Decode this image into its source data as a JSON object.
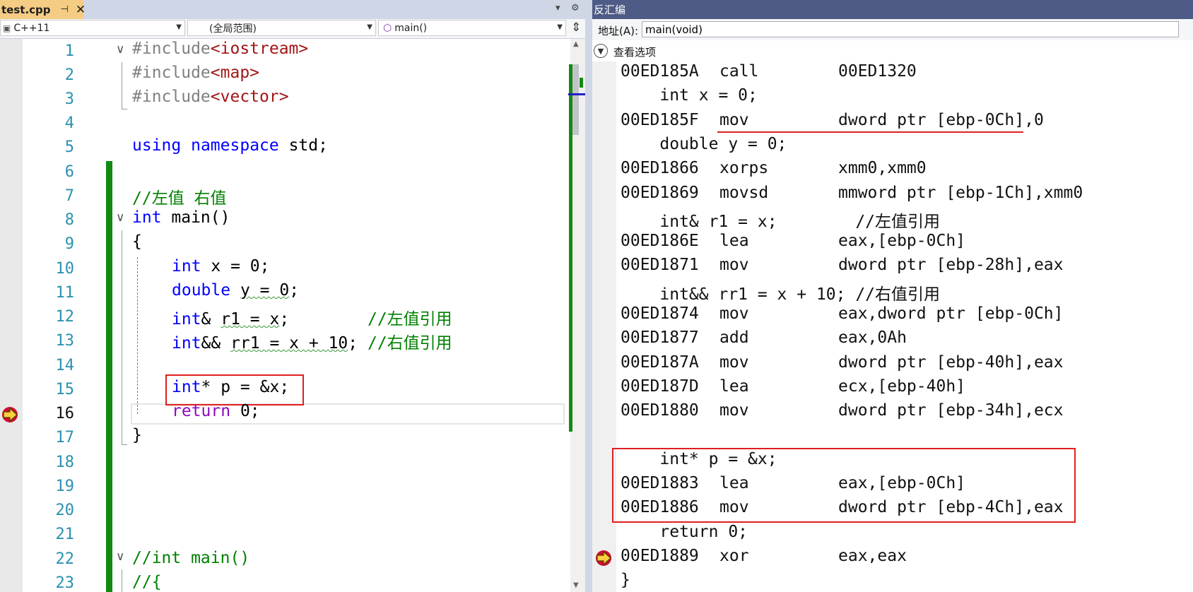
{
  "editor": {
    "tab_name": "test.cpp",
    "tab_pin": "⊣",
    "tab_close": "✕",
    "nav": {
      "project": "C++11",
      "scope": "(全局范围)",
      "function": "main()"
    },
    "line_numbers": [
      "1",
      "2",
      "3",
      "4",
      "5",
      "6",
      "7",
      "8",
      "9",
      "10",
      "11",
      "12",
      "13",
      "14",
      "15",
      "16",
      "17",
      "18",
      "19",
      "20",
      "21",
      "22",
      "23"
    ],
    "code": {
      "l1_pre": "#include",
      "l1_str": "<iostream>",
      "l2_pre": "#include",
      "l2_str": "<map>",
      "l3_pre": "#include",
      "l3_str": "<vector>",
      "l5_kw1": "using",
      "l5_kw2": "namespace",
      "l5_rest": " std;",
      "l7": "//左值 右值",
      "l8_kw": "int",
      "l8_rest": " main()",
      "l9": "{",
      "l10_kw": "int",
      "l10_rest": " x = 0;",
      "l11_kw": "double",
      "l11_sp": " ",
      "l11_sq": "y = 0",
      "l11_end": ";",
      "l12_kw": "int",
      "l12_amp": "& ",
      "l12_sq": "r1 = x",
      "l12_mid": ";        ",
      "l12_cm": "//左值引用",
      "l13_kw": "int",
      "l13_amp": "&& ",
      "l13_sq": "rr1 = x + 10",
      "l13_mid": "; ",
      "l13_cm": "//右值引用",
      "l15_kw": "int",
      "l15_rest": "* p = &x;",
      "l16_kw": "return",
      "l16_rest": " 0;",
      "l17": "}",
      "l22": "//int main()",
      "l23": "//{"
    }
  },
  "disasm": {
    "title": "反汇编",
    "address_label": "地址(A):",
    "address_value": "main(void)",
    "view_options": "查看选项",
    "lines": [
      {
        "addr": "00ED185A",
        "mn": "call",
        "op": "00ED1320"
      },
      {
        "src": "    int x = 0;"
      },
      {
        "addr": "00ED185F",
        "mn": "mov",
        "op": "dword ptr [ebp-0Ch],0"
      },
      {
        "src": "    double y = 0;"
      },
      {
        "addr": "00ED1866",
        "mn": "xorps",
        "op": "xmm0,xmm0"
      },
      {
        "addr": "00ED1869",
        "mn": "movsd",
        "op": "mmword ptr [ebp-1Ch],xmm0"
      },
      {
        "src": "    int& r1 = x;        //左值引用"
      },
      {
        "addr": "00ED186E",
        "mn": "lea",
        "op": "eax,[ebp-0Ch]"
      },
      {
        "addr": "00ED1871",
        "mn": "mov",
        "op": "dword ptr [ebp-28h],eax"
      },
      {
        "src": "    int&& rr1 = x + 10; //右值引用"
      },
      {
        "addr": "00ED1874",
        "mn": "mov",
        "op": "eax,dword ptr [ebp-0Ch]"
      },
      {
        "addr": "00ED1877",
        "mn": "add",
        "op": "eax,0Ah"
      },
      {
        "addr": "00ED187A",
        "mn": "mov",
        "op": "dword ptr [ebp-40h],eax"
      },
      {
        "addr": "00ED187D",
        "mn": "lea",
        "op": "ecx,[ebp-40h]"
      },
      {
        "addr": "00ED1880",
        "mn": "mov",
        "op": "dword ptr [ebp-34h],ecx"
      },
      {
        "src": ""
      },
      {
        "src": "    int* p = &x;"
      },
      {
        "addr": "00ED1883",
        "mn": "lea",
        "op": "eax,[ebp-0Ch]"
      },
      {
        "addr": "00ED1886",
        "mn": "mov",
        "op": "dword ptr [ebp-4Ch],eax"
      },
      {
        "src": "    return 0;"
      },
      {
        "addr": "00ED1889",
        "mn": "xor",
        "op": "eax,eax"
      },
      {
        "src": "}"
      }
    ]
  },
  "colors": {
    "keyword": "#0000ff",
    "type": "#2b91af",
    "string": "#a31515",
    "comment": "#008000",
    "highlight_box": "#e01f1f",
    "change_bar": "#128a12",
    "tab_active": "#f5cc84",
    "disasm_title": "#4e5b86"
  }
}
